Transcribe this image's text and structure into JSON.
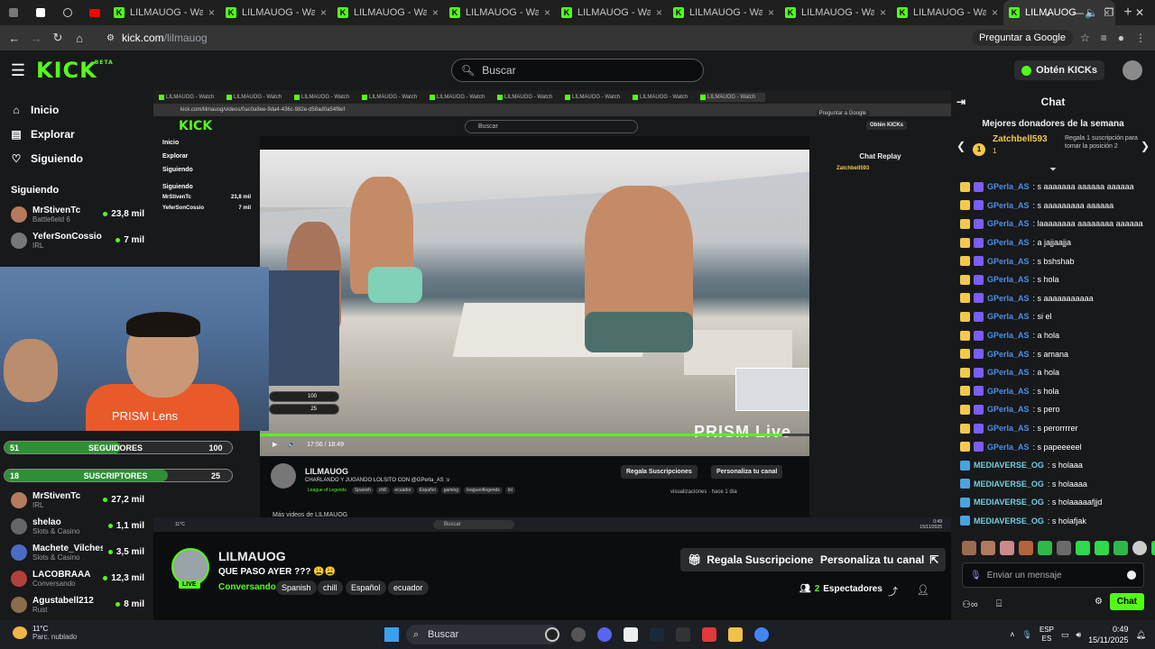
{
  "browser": {
    "tabs": [
      {
        "title": "LILMAUOG - Watch LI"
      },
      {
        "title": "LILMAUOG - Watch LI"
      },
      {
        "title": "LILMAUOG - Watch LI"
      },
      {
        "title": "LILMAUOG - Watch LI"
      },
      {
        "title": "LILMAUOG - Watch LI"
      },
      {
        "title": "LILMAUOG - Watch LI"
      },
      {
        "title": "LILMAUOG - Watch LI"
      },
      {
        "title": "LILMAUOG - Watch LI"
      }
    ],
    "active_tab": {
      "title": "LILMAUOG Strea"
    },
    "url_host": "kick.com",
    "url_path": "/lilmauog",
    "google_btn": "Preguntar a Google"
  },
  "header": {
    "logo": "KICK",
    "logo_sup": "BETA",
    "search_placeholder": "Buscar",
    "get_kicks": "Obtén KICKs"
  },
  "sidebar": {
    "nav": [
      {
        "label": "Inicio",
        "icon": "home-icon"
      },
      {
        "label": "Explorar",
        "icon": "compass-icon"
      },
      {
        "label": "Siguiendo",
        "icon": "heart-icon"
      }
    ],
    "following_title": "Siguiendo",
    "following": [
      {
        "name": "MrStivenTc",
        "category": "Battlefield 6",
        "viewers": "23,8 mil"
      },
      {
        "name": "YeferSonCossio",
        "category": "IRL",
        "viewers": "7 mil"
      }
    ],
    "following_lower": [
      {
        "name": "MrStivenTc",
        "category": "IRL",
        "viewers": "27,2 mil"
      },
      {
        "name": "shelao",
        "category": "Slots & Casino",
        "viewers": "1,1 mil"
      },
      {
        "name": "Machete_Vilches",
        "category": "Slots & Casino",
        "viewers": "3,5 mil"
      },
      {
        "name": "LACOBRAAA",
        "category": "Conversando",
        "viewers": "12,3 mil"
      },
      {
        "name": "Agustabell212",
        "category": "Rust",
        "viewers": "8 mil"
      }
    ]
  },
  "nested": {
    "tabs": [
      "LILMAUOG - Watch",
      "LILMAUOG - Watch",
      "LILMAUOG - Watch",
      "LILMAUOG - Watch",
      "LILMAUOG - Watch",
      "LILMAUOG - Watch",
      "LILMAUOG - Watch",
      "LILMAUOG - Watch"
    ],
    "active_tab": "LILMAUOG - Watch",
    "url": "kick.com/lilmauog/videos/0ac0a8ee-9da4-436c-982e-d58ad0a54f8ef",
    "google_btn": "Preguntar a Google",
    "search": "Buscar",
    "get_kicks": "Obtén KICKs",
    "nav": [
      "Inicio",
      "Explorar",
      "Siguiendo"
    ],
    "following_title": "Siguiendo",
    "following": [
      {
        "name": "MrStivenTc",
        "viewers": "23,8 mil"
      },
      {
        "name": "YeferSonCossio",
        "viewers": "7 mil"
      }
    ],
    "chat_title": "Chat Replay",
    "donor": "Zatchbell593",
    "time": "17:56 / 18:49",
    "video_progress": 0.95,
    "channel": "LILMAUOG",
    "title": "CHARLANDO Y JUGANDO LOLSITO CON @GPerla_AS :v",
    "category": "League of Legends",
    "tags": [
      "Spanish",
      "chill",
      "ecuador",
      "Español",
      "gaming",
      "leagueoflegends",
      "lol"
    ],
    "sub_btn": "Regala Suscripciones",
    "custom_btn": "Personaliza tu canal",
    "views": "visualizaciones · hace 1 día",
    "more_videos": "Más videos de LILMAUOG",
    "search_taskbar": "Buscar",
    "weather": "11°C",
    "clock": "0:49",
    "date": "15/11/2025",
    "overlay_values": [
      "100",
      "25"
    ]
  },
  "overlay": {
    "prism_lens": "PRISM Lens",
    "prism_live": "PRISM Live",
    "followers_goal": {
      "left": "51",
      "label": "SEGUIDORES",
      "right": "100",
      "progress": 0.51
    },
    "subs_goal": {
      "left": "18",
      "label": "SUSCRIPTORES",
      "right": "25",
      "progress": 0.72
    }
  },
  "stream": {
    "channel": "LILMAUOG",
    "title": "QUE PASO AYER ??? 😩😩",
    "category": "Conversando",
    "tags": [
      "Spanish",
      "chill",
      "Español",
      "ecuador"
    ],
    "live": "LIVE",
    "sub_btn": "Regala Suscripciones",
    "custom_btn": "Personaliza tu canal",
    "viewers_count": "2",
    "viewers_label": "Espectadores"
  },
  "chat": {
    "title": "Chat",
    "donors_title": "Mejores donadores de la semana",
    "donor_name": "Zatchbell593",
    "donor_count": "1",
    "donor_desc": "Regala 1 suscripción para tomar la posición 2",
    "messages": [
      {
        "user": "GPerla_AS",
        "text": ": s aaaaaaa aaaaaa aaaaaa",
        "color": "u1"
      },
      {
        "user": "GPerla_AS",
        "text": ": s aaaaaaaaa aaaaaa",
        "color": "u1"
      },
      {
        "user": "GPerla_AS",
        "text": ": laaaaaaaa aaaaaaaa aaaaaa",
        "color": "u1"
      },
      {
        "user": "GPerla_AS",
        "text": ": a jajjaajja",
        "color": "u1"
      },
      {
        "user": "GPerla_AS",
        "text": ": s bshshab",
        "color": "u1"
      },
      {
        "user": "GPerla_AS",
        "text": ": s hola",
        "color": "u1"
      },
      {
        "user": "GPerla_AS",
        "text": ": s aaaaaaaaaaa",
        "color": "u1"
      },
      {
        "user": "GPerla_AS",
        "text": ": si el",
        "color": "u1"
      },
      {
        "user": "GPerla_AS",
        "text": ": a hola",
        "color": "u1"
      },
      {
        "user": "GPerla_AS",
        "text": ": s amana",
        "color": "u1"
      },
      {
        "user": "GPerla_AS",
        "text": ": a hola",
        "color": "u1"
      },
      {
        "user": "GPerla_AS",
        "text": ": s hola",
        "color": "u1"
      },
      {
        "user": "GPerla_AS",
        "text": ": s pero",
        "color": "u1"
      },
      {
        "user": "GPerla_AS",
        "text": ": s perorrrrer",
        "color": "u1"
      },
      {
        "user": "GPerla_AS",
        "text": ": s papeeeeel",
        "color": "u1"
      },
      {
        "user": "MEDIAVERSE_OG",
        "text": ": s holaaa",
        "color": "u2"
      },
      {
        "user": "MEDIAVERSE_OG",
        "text": ": s holaaaa",
        "color": "u2"
      },
      {
        "user": "MEDIAVERSE_OG",
        "text": ": s holaaaaafjjd",
        "color": "u2"
      },
      {
        "user": "MEDIAVERSE_OG",
        "text": ": s holafjak",
        "color": "u2"
      }
    ],
    "input_placeholder": "Enviar un mensaje",
    "send_btn": "Chat"
  },
  "taskbar": {
    "weather_temp": "11°C",
    "weather_desc": "Parc. nublado",
    "search": "Buscar",
    "lang1": "ESP",
    "lang2": "ES",
    "time": "0:49",
    "date": "15/11/2025"
  },
  "colors": {
    "kick_green": "#53fc18",
    "bg": "#0b0e0f",
    "panel": "#18191b"
  }
}
